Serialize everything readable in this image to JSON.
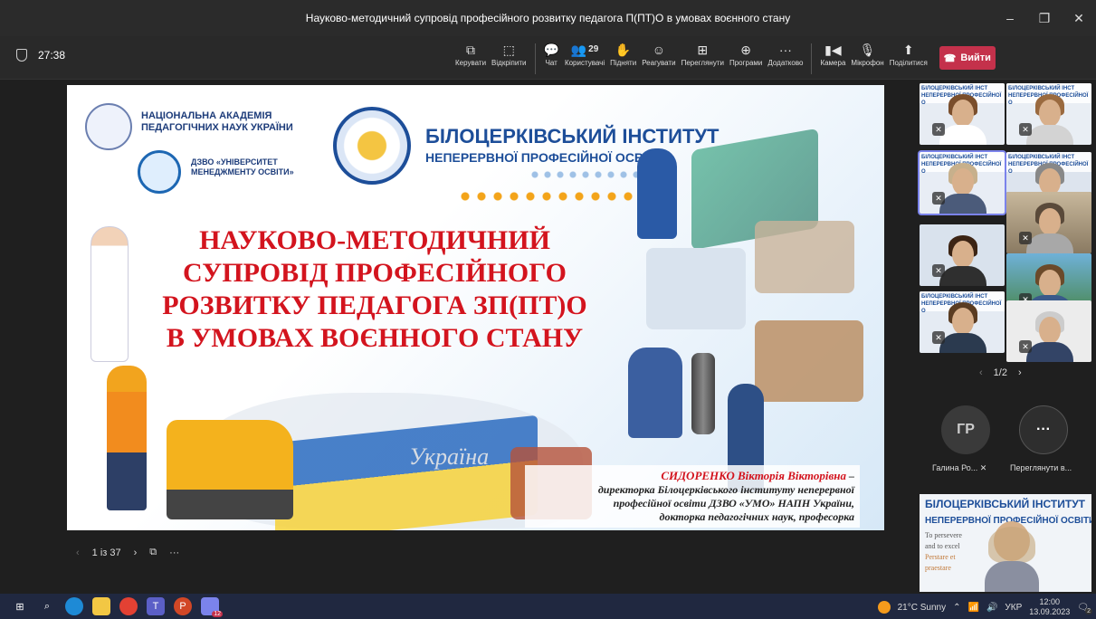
{
  "window": {
    "title": "Науково-методичний супровід професійного розвитку педагога П(ПТ)О в умовах воєнного стану",
    "min": "–",
    "max": "❐",
    "close": "✕"
  },
  "meeting": {
    "timer": "27:38"
  },
  "toolbar": {
    "items": [
      {
        "label": "Керувати",
        "icon": "screen-share-icon",
        "glyph": "⧉"
      },
      {
        "label": "Відкріпити",
        "icon": "unpin-icon",
        "glyph": "⬚"
      },
      {
        "label": "Чат",
        "icon": "chat-icon",
        "glyph": "💬"
      },
      {
        "label": "Користувачі",
        "icon": "people-icon",
        "glyph": "👥",
        "count": "29"
      },
      {
        "label": "Підняти",
        "icon": "raise-hand-icon",
        "glyph": "✋"
      },
      {
        "label": "Реагувати",
        "icon": "react-icon",
        "glyph": "☺"
      },
      {
        "label": "Переглянути",
        "icon": "view-icon",
        "glyph": "⊞"
      },
      {
        "label": "Програми",
        "icon": "apps-icon",
        "glyph": "⊕"
      },
      {
        "label": "Додатково",
        "icon": "more-icon",
        "glyph": "···"
      }
    ],
    "camera": "Камера",
    "mic": "Мікрофон",
    "share": "Поділитися",
    "leave": "Вийти"
  },
  "slide": {
    "academy": "НАЦІОНАЛЬНА АКАДЕМІЯ ПЕДАГОГІЧНИХ НАУК УКРАЇНИ",
    "university": "ДЗВО «УНІВЕРСИТЕТ МЕНЕДЖМЕНТУ ОСВІТИ»",
    "institute_title": "БІЛОЦЕРКІВСЬКИЙ ІНСТИТУТ",
    "institute_sub": "НЕПЕРЕРВНОЇ ПРОФЕСІЙНОЇ ОСВІТИ",
    "headline_1": "НАУКОВО-МЕТОДИЧНИЙ",
    "headline_2": "СУПРОВІД ПРОФЕСІЙНОГО",
    "headline_3": "РОЗВИТКУ ПЕДАГОГА ЗП(ПТ)О",
    "headline_4": "В УМОВАХ ВОЄННОГО СТАНУ",
    "map_word": "Україна",
    "speaker_name": "СИДОРЕНКО Вікторія Вікторівна",
    "speaker_dash": " –",
    "speaker_line1": "директорка Білоцерківського інституту неперервної",
    "speaker_line2": "професійної освіти ДЗВО «УМО» НАПН України,",
    "speaker_line3": "докторка педагогічних наук, професорка"
  },
  "pager": {
    "prev": "‹",
    "page": "1 із 37",
    "next": "›",
    "more": "···"
  },
  "gallery": {
    "page": "1/2",
    "banner": "БІЛОЦЕРКІВСЬКИЙ ІНСТ НЕПЕРЕРВНОЇ ПРОФЕСІЙНОЇ О",
    "avatar_initials": "ГР",
    "avatar_name": "Галина Ро...",
    "more_label": "Переглянути в...",
    "more_glyph": "···"
  },
  "selfview": {
    "title": "БІЛОЦЕРКІВСЬКИЙ ІНСТИТУТ",
    "sub": "НЕПЕРЕРВНОЇ ПРОФЕСІЙНОЇ ОСВІТИ",
    "motto1": "To persevere",
    "motto2": "and to excel",
    "motto3": "Perstare et praestare"
  },
  "taskbar": {
    "weather": "21°C  Sunny",
    "lang": "УКР",
    "time": "12:00",
    "date": "13.09.2023",
    "notif": "2",
    "teams_badge": "12"
  }
}
